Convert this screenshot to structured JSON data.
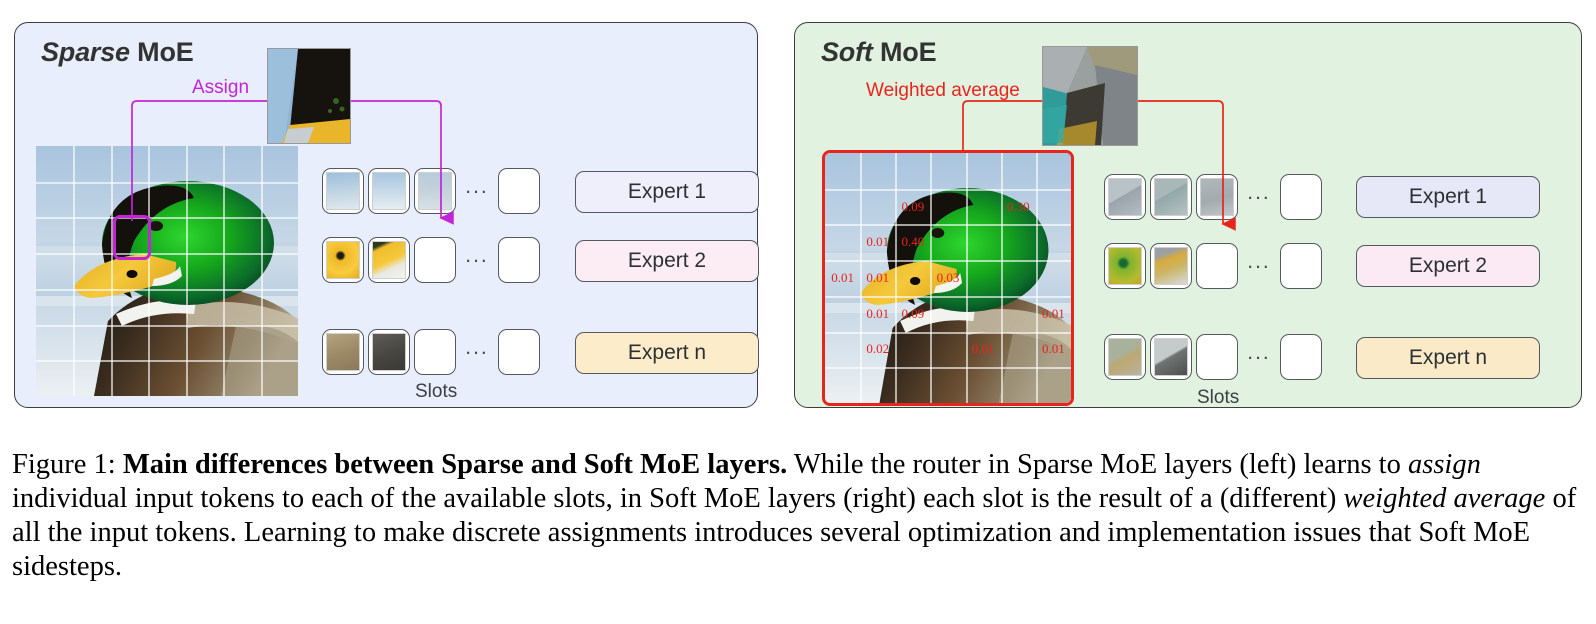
{
  "figure": {
    "number_label": "Figure 1:",
    "caption_bold": "Main differences between Sparse and Soft MoE layers.",
    "caption_part1": " While the router in Sparse MoE layers (left) learns to ",
    "caption_italic1": "assign",
    "caption_part2": " individual input tokens to each of the available slots, in Soft MoE layers (right) each slot is the result of a (different) ",
    "caption_italic2": "weighted average",
    "caption_part3": " of all the input tokens. Learning to make discrete assignments introduces several optimization and implementation issues that Soft MoE sidesteps."
  },
  "sparse_panel": {
    "title_em": "Sparse",
    "title_rest": " MoE",
    "connector_label": "Assign",
    "slots_label": "Slots",
    "accent_color": "#c224d6",
    "background_color": "#e8eefc",
    "experts": [
      {
        "label": "Expert 1",
        "color": "#efeefb"
      },
      {
        "label": "Expert 2",
        "color": "#fcedf5"
      },
      {
        "label": "Expert n",
        "color": "#fcecc9"
      }
    ],
    "slot_rows": [
      {
        "filled": [
          "sky-patch-1",
          "sky-patch-2",
          "sky-patch-3"
        ],
        "empty_after": 0,
        "dots": "...",
        "trailing_empty": 1
      },
      {
        "filled": [
          "beak-eye-patch",
          "beak-patch"
        ],
        "empty_after": 1,
        "dots": "...",
        "trailing_empty": 1
      },
      {
        "filled": [
          "body-tan-patch",
          "body-dark-patch"
        ],
        "empty_after": 1,
        "dots": "...",
        "trailing_empty": 1
      }
    ]
  },
  "soft_panel": {
    "title_em": "Soft",
    "title_rest": " MoE",
    "connector_label": "Weighted average",
    "slots_label": "Slots",
    "accent_color": "#e8251c",
    "background_color": "#e2f2e0",
    "experts": [
      {
        "label": "Expert 1",
        "color": "#e6e8f7"
      },
      {
        "label": "Expert 2",
        "color": "#fbeaf3"
      },
      {
        "label": "Expert n",
        "color": "#fbeac8"
      }
    ],
    "slot_rows": [
      {
        "filled": [
          "mix-gray-1",
          "mix-teal-2",
          "mix-gray-3"
        ],
        "empty_after": 0,
        "dots": "...",
        "trailing_empty": 1
      },
      {
        "filled": [
          "mix-green-1",
          "mix-beak-2"
        ],
        "empty_after": 1,
        "dots": "...",
        "trailing_empty": 1
      },
      {
        "filled": [
          "mix-tan-1",
          "mix-dark-2"
        ],
        "empty_after": 1,
        "dots": "...",
        "trailing_empty": 1
      }
    ],
    "weights": [
      {
        "value": "0.09",
        "col": 2,
        "row": 1
      },
      {
        "value": "0.30",
        "col": 5,
        "row": 1
      },
      {
        "value": "0.01",
        "col": 1,
        "row": 2
      },
      {
        "value": "0.40",
        "col": 2,
        "row": 2
      },
      {
        "value": "0.01",
        "col": 0,
        "row": 3
      },
      {
        "value": "0.01",
        "col": 1,
        "row": 3
      },
      {
        "value": "0.03",
        "col": 3,
        "row": 3
      },
      {
        "value": "0.01",
        "col": 1,
        "row": 4
      },
      {
        "value": "0.09",
        "col": 2,
        "row": 4
      },
      {
        "value": "0.01",
        "col": 6,
        "row": 4
      },
      {
        "value": "0.02",
        "col": 1,
        "row": 5
      },
      {
        "value": "0.01",
        "col": 4,
        "row": 5
      },
      {
        "value": "0.01",
        "col": 6,
        "row": 5
      }
    ]
  },
  "grid": {
    "rows": 7,
    "cols": 7
  }
}
